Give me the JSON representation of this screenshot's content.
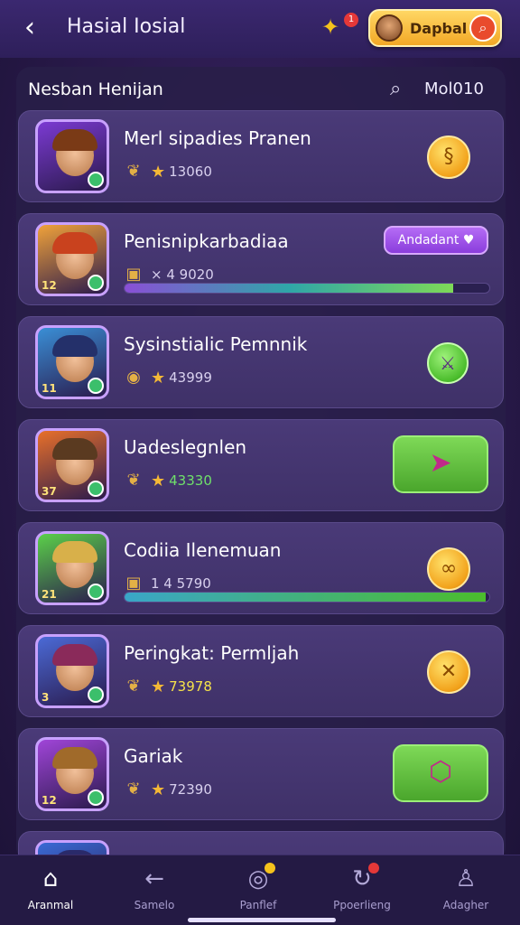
{
  "header": {
    "back_icon": "chevron-left-icon",
    "title": "Hasial Iosial",
    "badge_icon": "puzzle-icon",
    "badge_count": "1",
    "profile_label": "Dapbal",
    "profile_search_icon": "search-icon"
  },
  "panel": {
    "title": "Nesban Henijan",
    "search_icon": "search-icon",
    "search_label": "Mol010"
  },
  "rows": [
    {
      "name": "Merl sipadies Pranen",
      "meta_icon": "wing-icon",
      "value": "13060",
      "value_style": "normal",
      "action": "coin",
      "action_icon": "swirl-icon",
      "level": "",
      "colors": {
        "bg": "#7b3ad2",
        "hair": "#7a3a16"
      }
    },
    {
      "name": "Penisnipkarbadiaa",
      "meta_icon": "chest-icon",
      "value": "× 4 9020",
      "value_style": "normal",
      "action": "pill",
      "pill_label": "Andadant ♥",
      "level": "12",
      "progress": 0.9,
      "progress_colors": [
        "#8a4fd6",
        "#2fa6a8",
        "#7ed957"
      ],
      "colors": {
        "bg": "#f0a23a",
        "hair": "#c9421e"
      }
    },
    {
      "name": "Sysinstialic Pemnnik",
      "meta_icon": "medal-icon",
      "value": "43999",
      "value_style": "normal",
      "action": "green-circle",
      "action_icon": "sword-icon",
      "level": "11",
      "colors": {
        "bg": "#3a8fd6",
        "hair": "#24306a"
      }
    },
    {
      "name": "Uadeslegnlen",
      "meta_icon": "wing-icon",
      "value": "43330",
      "value_style": "green",
      "action": "green-button",
      "action_icon": "horn-icon",
      "level": "37",
      "colors": {
        "bg": "#e8702a",
        "hair": "#5a3a20"
      }
    },
    {
      "name": "Codiia Ilenemuan",
      "meta_icon": "chest-icon",
      "value": "1 4 5790",
      "value_style": "normal",
      "action": "coin",
      "action_icon": "knot-icon",
      "level": "21",
      "progress": 0.99,
      "progress_colors": [
        "#3aa6c8",
        "#4bbd2c"
      ],
      "colors": {
        "bg": "#5bd04a",
        "hair": "#d8b04a"
      }
    },
    {
      "name": "Peringkat: Permljah",
      "meta_icon": "wing-icon",
      "value": "73978",
      "value_style": "yellow",
      "action": "coin",
      "action_icon": "cross-icon",
      "level": "3",
      "colors": {
        "bg": "#4b6ad6",
        "hair": "#8a2a5a"
      }
    },
    {
      "name": "Gariak",
      "meta_icon": "wing-icon",
      "value": "72390",
      "value_style": "normal",
      "action": "green-button",
      "action_icon": "box-icon",
      "level": "12",
      "colors": {
        "bg": "#a045d8",
        "hair": "#a06a2a"
      }
    },
    {
      "name": "",
      "meta_icon": "",
      "value": "",
      "value_style": "normal",
      "action": "none",
      "level": "",
      "colors": {
        "bg": "#3a6ad6",
        "hair": "#2a2a6a"
      }
    }
  ],
  "nav": [
    {
      "label": "Aranmal",
      "icon": "home-icon",
      "active": true,
      "dot": ""
    },
    {
      "label": "Samelo",
      "icon": "arrow-left-icon",
      "active": false,
      "dot": ""
    },
    {
      "label": "Panflef",
      "icon": "target-icon",
      "active": false,
      "dot": "#f5c21c"
    },
    {
      "label": "Ppoerlieng",
      "icon": "refresh-icon",
      "active": false,
      "dot": "#e53838"
    },
    {
      "label": "Adagher",
      "icon": "user-icon",
      "active": false,
      "dot": ""
    }
  ]
}
